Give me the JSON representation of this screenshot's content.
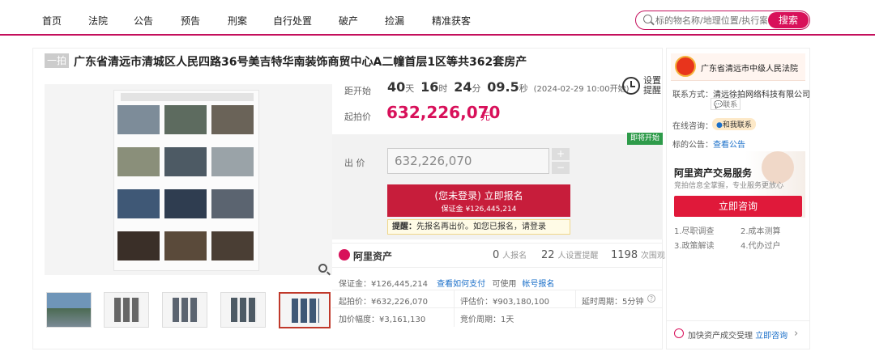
{
  "nav": {
    "items": [
      "首页",
      "法院",
      "公告",
      "预告",
      "刑案",
      "自行处置",
      "破产",
      "捡漏",
      "精准获客"
    ],
    "search_placeholder": "标的物名称/地理位置/执行案号",
    "search_button": "搜索"
  },
  "auction": {
    "tag": "一拍",
    "title": "广东省清远市清城区人民四路36号美吉特华南装饰商贸中心A二幢首层1区等共362套房产"
  },
  "countdown": {
    "label": "距开始",
    "days": "40",
    "days_unit": "天",
    "hours": "16",
    "hours_unit": "时",
    "minutes": "24",
    "minutes_unit": "分",
    "seconds": "09.5",
    "seconds_unit": "秒",
    "start": "(2024-02-29 10:00开始)",
    "reminder": "设置",
    "reminder2": "提醒"
  },
  "price": {
    "label": "起拍价",
    "value": "632,226,070",
    "unit": "元"
  },
  "bid": {
    "badge": "即将开始",
    "label": "出 价",
    "value": "632,226,070",
    "plus": "+",
    "minus": "−",
    "register_label": "(您未登录) 立即报名",
    "deposit_label": "保证金 ¥126,445,214"
  },
  "hint": {
    "label": "提醒：",
    "text": "先报名再出价。如您已报名，请登录"
  },
  "stats": {
    "brand": "阿里资产",
    "applicants": "0",
    "applicants_label": "人报名",
    "reminders": "22",
    "reminders_label": "人设置提醒",
    "views": "1198",
    "views_label": "次围观"
  },
  "details": {
    "deposit_label": "保证金：",
    "deposit": "¥126,445,214",
    "how_to_pay": "查看如何支付",
    "can_use": "可使用",
    "alipay": "帐号报名",
    "start_price_label": "起拍价：",
    "start_price": "¥632,226,070",
    "eval_label": "评估价：",
    "eval": "¥903,180,100",
    "delay_label": "延时周期：",
    "delay": "5分钟",
    "increment_label": "加价幅度：",
    "increment": "¥3,161,130",
    "period_label": "竞价周期：",
    "period": "1天"
  },
  "court": {
    "name": "广东省清远市中级人民法院",
    "contact_label": "联系方式：",
    "contact": "清远徐拍网络科技有限公司",
    "contact_btn": "联系",
    "online_label": "在线咨询：",
    "online_btn": "和我联系",
    "notice_label": "标的公告：",
    "notice_link": "查看公告"
  },
  "service": {
    "title": "阿里资产交易服务",
    "subtitle": "竞拍信息全掌握，专业服务更放心",
    "consult_btn": "立即咨询",
    "items": [
      "1.尽职调查",
      "2.成本测算",
      "3.政策解读",
      "4.代办过户"
    ],
    "footer_text": "加快资产成交受理",
    "footer_link": "立即咨询"
  },
  "colors": {
    "brand": "#d8105a",
    "accent": "#c40f5c"
  }
}
